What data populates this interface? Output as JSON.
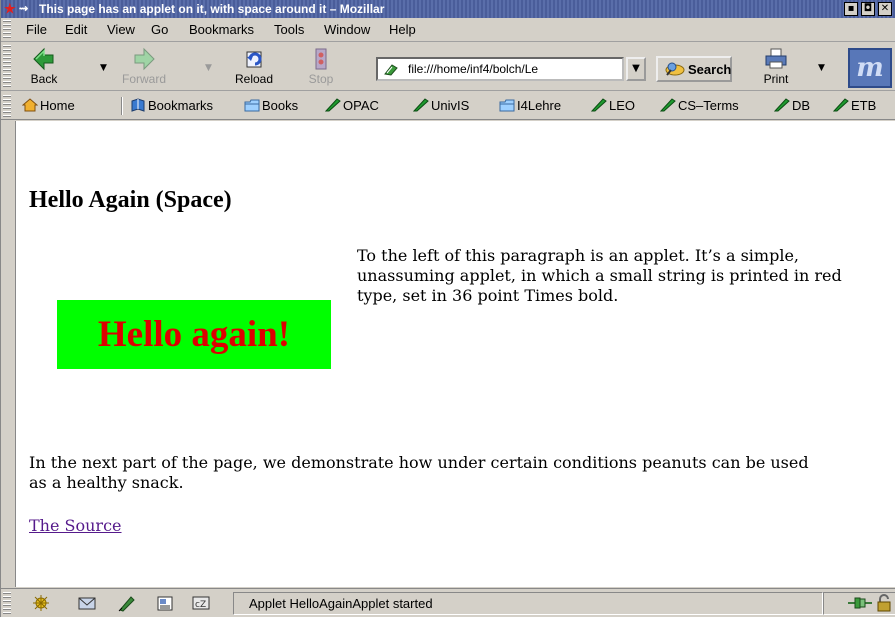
{
  "window": {
    "title": "This page has an applet on it, with space around it – Mozillar",
    "min_label": "▪",
    "max_label": "◘",
    "close_label": "✕"
  },
  "menu": [
    {
      "label": "File"
    },
    {
      "label": "Edit"
    },
    {
      "label": "View"
    },
    {
      "label": "Go"
    },
    {
      "label": "Bookmarks"
    },
    {
      "label": "Tools"
    },
    {
      "label": "Window"
    },
    {
      "label": "Help"
    }
  ],
  "toolbar": {
    "back_label": "Back",
    "forward_label": "Forward",
    "reload_label": "Reload",
    "stop_label": "Stop",
    "url_value": "file:///home/inf4/bolch/Le",
    "search_label": "Search",
    "print_label": "Print"
  },
  "personal_bar": [
    {
      "label": "Home",
      "icon": "home-icon"
    },
    {
      "label": "Bookmarks",
      "icon": "bookmarks-icon"
    },
    {
      "label": "Books",
      "icon": "folder-icon"
    },
    {
      "label": "OPAC",
      "icon": "bookmark-link-icon"
    },
    {
      "label": "UnivIS",
      "icon": "bookmark-link-icon"
    },
    {
      "label": "I4Lehre",
      "icon": "folder-icon"
    },
    {
      "label": "LEO",
      "icon": "bookmark-link-icon"
    },
    {
      "label": "CS–Terms",
      "icon": "bookmark-link-icon"
    },
    {
      "label": "DB",
      "icon": "bookmark-link-icon"
    },
    {
      "label": "ETB",
      "icon": "bookmark-link-icon"
    }
  ],
  "page": {
    "heading": "Hello Again (Space)",
    "applet_text": "Hello again!",
    "applet_bg": "#00ff00",
    "applet_fg": "#dd0000",
    "para1_lines": [
      "To the left of this paragraph is an applet. It’s a simple,",
      "unassuming applet, in which a small string is printed in red",
      "type, set in 36 point Times bold."
    ],
    "para2_lines": [
      "In the next part of the page, we demonstrate how under certain conditions peanuts can be used",
      "as a healthy snack."
    ],
    "link_text": "The Source"
  },
  "status": {
    "text": "Applet HelloAgainApplet started"
  }
}
